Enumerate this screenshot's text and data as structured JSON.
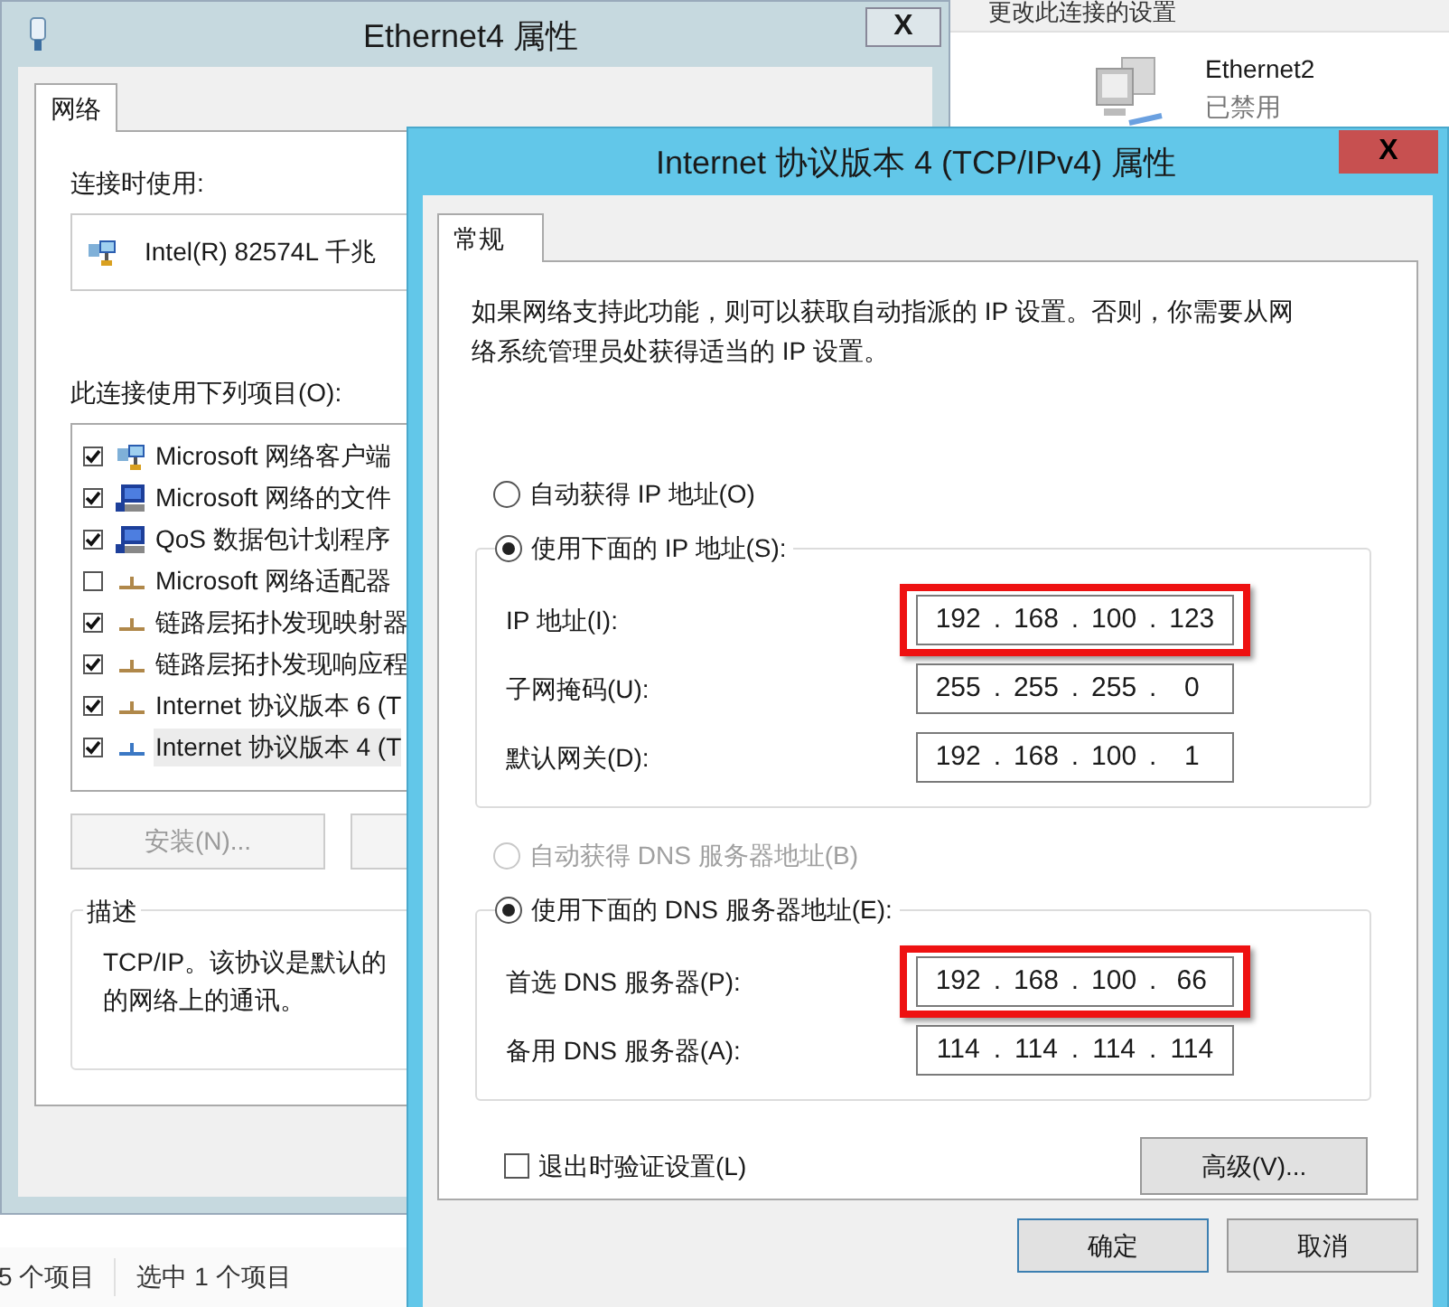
{
  "explorer": {
    "header": "更改此连接的设置",
    "adapter": {
      "name": "Ethernet2",
      "status": "已禁用"
    }
  },
  "status_bar": {
    "item_count": "5 个项目",
    "selection": "选中 1 个项目"
  },
  "ethernet_dialog": {
    "title": "Ethernet4 属性",
    "close": "X",
    "tabs": [
      {
        "label": "网络",
        "selected": true
      }
    ],
    "connect_using_label": "连接时使用:",
    "adapter_name": "Intel(R) 82574L 千兆",
    "items_label": "此连接使用下列项目(O):",
    "items": [
      {
        "kind": "client",
        "label": "Microsoft 网络客户端",
        "checked": true,
        "selected": false
      },
      {
        "kind": "service",
        "label": "Microsoft 网络的文件",
        "checked": true,
        "selected": false
      },
      {
        "kind": "service",
        "label": "QoS 数据包计划程序",
        "checked": true,
        "selected": false
      },
      {
        "kind": "protocol",
        "label": "Microsoft 网络适配器",
        "checked": false,
        "selected": false
      },
      {
        "kind": "protocol",
        "label": "链路层拓扑发现映射器",
        "checked": true,
        "selected": false
      },
      {
        "kind": "protocol",
        "label": "链路层拓扑发现响应程",
        "checked": true,
        "selected": false
      },
      {
        "kind": "protocol",
        "label": "Internet 协议版本 6 (T",
        "checked": true,
        "selected": false
      },
      {
        "kind": "protocol",
        "label": "Internet 协议版本 4 (T",
        "checked": true,
        "selected": true
      }
    ],
    "buttons": [
      {
        "label": "安装(N)...",
        "disabled": true
      }
    ],
    "description": {
      "label": "描述",
      "lines": [
        "TCP/IP。该协议是默认的",
        "的网络上的通讯。"
      ]
    }
  },
  "ipv4_dialog": {
    "title": "Internet 协议版本 4 (TCP/IPv4) 属性",
    "close": "X",
    "tabs": [
      {
        "label": "常规",
        "selected": true
      }
    ],
    "intro": "如果网络支持此功能，则可以获取自动指派的 IP 设置。否则，你需要从网络系统管理员处获得适当的 IP 设置。",
    "ip_options": [
      {
        "label": "自动获得 IP 地址(O)",
        "selected": false,
        "disabled": false
      },
      {
        "label": "使用下面的 IP 地址(S):",
        "selected": true,
        "disabled": false
      }
    ],
    "ip_fields": [
      {
        "label": "IP 地址(I):",
        "segments": [
          "192",
          ".",
          "168",
          ".",
          "100",
          ".",
          "123"
        ],
        "highlighted": true
      },
      {
        "label": "子网掩码(U):",
        "segments": [
          "255",
          ".",
          "255",
          ".",
          "255",
          ".",
          "0"
        ],
        "highlighted": false
      },
      {
        "label": "默认网关(D):",
        "segments": [
          "192",
          ".",
          "168",
          ".",
          "100",
          ".",
          "1"
        ],
        "highlighted": false
      }
    ],
    "dns_options": [
      {
        "label": "自动获得 DNS 服务器地址(B)",
        "selected": false,
        "disabled": true
      },
      {
        "label": "使用下面的 DNS 服务器地址(E):",
        "selected": true,
        "disabled": false
      }
    ],
    "dns_fields": [
      {
        "label": "首选 DNS 服务器(P):",
        "segments": [
          "192",
          ".",
          "168",
          ".",
          "100",
          ".",
          "66"
        ],
        "highlighted": true
      },
      {
        "label": "备用 DNS 服务器(A):",
        "segments": [
          "114",
          ".",
          "114",
          ".",
          "114",
          ".",
          "114"
        ],
        "highlighted": false
      }
    ],
    "validate": {
      "label": "退出时验证设置(L)",
      "checked": false
    },
    "advanced_button": "高级(V)...",
    "buttons": [
      {
        "label": "确定",
        "default": true
      },
      {
        "label": "取消",
        "default": false
      }
    ]
  }
}
